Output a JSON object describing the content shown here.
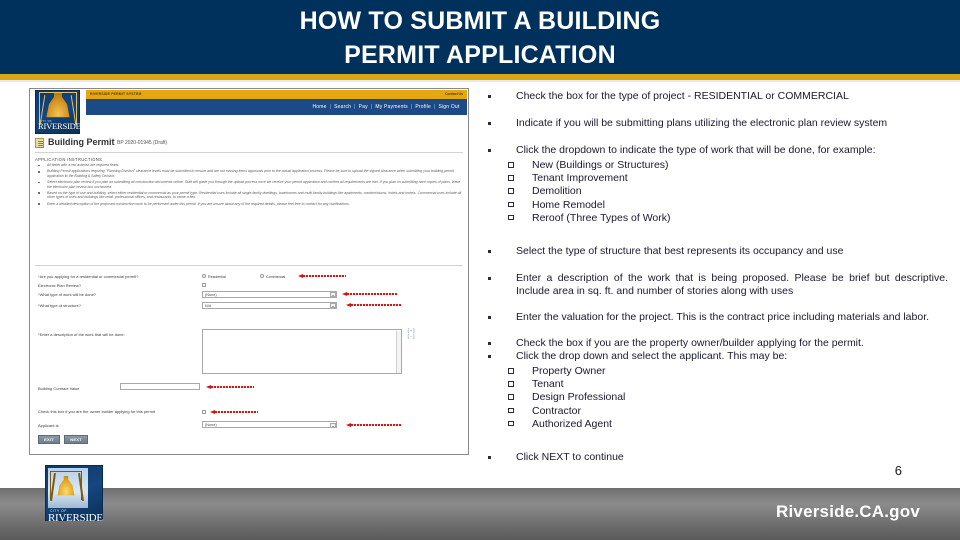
{
  "slide": {
    "title_line1": "HOW TO SUBMIT A BUILDING",
    "title_line2": "PERMIT APPLICATION",
    "page_number": "6",
    "footer_text": "Riverside.CA.gov",
    "colors": {
      "navy": "#00305c",
      "gold": "#d8a715",
      "footer_gray": "#6f6f6f",
      "annotation_red": "#d01616"
    }
  },
  "screenshot": {
    "brand": {
      "city_of": "CITY OF",
      "city_name": "RIVERSIDE"
    },
    "gold_bar_left": "RIVERSIDE PERMIT SYSTEM",
    "gold_bar_right": "Contact Us",
    "nav_links": [
      "Home",
      "Search",
      "Pay",
      "My Payments",
      "Profile",
      "Sign Out"
    ],
    "nav_separator": "|",
    "doc_title": "Building Permit",
    "doc_subtitle": "BP 2020-01945 (Draft)",
    "instructions_heading": "APPLICATION INSTRUCTIONS",
    "instructions": [
      "All fields with a red asterisk are required fields.",
      "Building Permit applications requiring \"Planning Division\" clearance levels must be submitted to ensure and are not missing items approvals prior to the actual application process. Please be sure to upload the signed clearance when submitting your building permit application to the Building & Safety Division.",
      "Select electronic plan review if you plan on submitting all construction documents online. Staff will guide you through the upload process once we receive your permit application and confirm all requirements are met. If you plan on submitting hard copies of plans, leave the electronic plan review box unchecked.",
      "Based on the type of use and building, select either residential or commercial as your permit type. Residential uses include all single-family dwellings, townhomes and multi-family buildings like apartments, condominiums, hotels and motels. Commercial uses include all other types of uses and buildings like retail, professional offices, and restaurants, to name a few.",
      "Enter a detailed description of the proposed construction work to be performed under this permit. If you are unsure about any of the required details, please feel free to contact for any clarifications."
    ],
    "form": {
      "q_permit_type": "Are you applying for a residential or commercial permit?",
      "opt_residential": "Residential",
      "opt_commercial": "Commercial",
      "q_electronic_plan_review": "Electronic Plan Review?",
      "q_type_of_work": "What type of work will be done?",
      "v_type_of_work": "(None)",
      "q_type_of_structure": "What type of structure?",
      "v_type_of_structure": "N/A",
      "q_description": "Enter a description of the work that will be done:",
      "v_description": "",
      "q_contract_value": "Building Contract Value",
      "v_contract_value": "",
      "q_owner_builder": "Check this box if you are the owner builder applying for this permit",
      "q_applicant_is": "Applicant is:",
      "v_applicant_is": "(None)",
      "btn_exit": "EXIT",
      "btn_next": "NEXT",
      "expand_icon": "[+]",
      "collapse_icon": "[-]"
    }
  },
  "bullets": [
    {
      "text": "Check the box for the type of project - RESIDENTIAL or COMMERCIAL",
      "sub": []
    },
    {
      "text": "Indicate if you will be submitting plans utilizing the electronic plan review system",
      "sub": []
    },
    {
      "text": "Click the dropdown to indicate the type of work that will be done, for example:",
      "sub": [
        "New (Buildings or Structures)",
        "Tenant Improvement",
        "Demolition",
        "Home Remodel",
        "Reroof (Three Types of Work)"
      ]
    },
    {
      "text": "Select the type of structure that best represents its occupancy and use",
      "sub": []
    },
    {
      "text": "Enter a description of the work that is being proposed. Please be brief but descriptive. Include area in sq. ft. and number of stories along with uses",
      "sub": []
    },
    {
      "text": "Enter the valuation for the project. This is the contract price including materials and labor.",
      "sub": []
    },
    {
      "text": "Check the box if you are the property owner/builder applying for the permit.",
      "sub": []
    },
    {
      "text": "Click the drop down and select the applicant.  This may be:",
      "sub": [
        "Property Owner",
        "Tenant",
        "Design Professional",
        "Contractor",
        "Authorized Agent"
      ]
    },
    {
      "text": "Click NEXT to continue",
      "sub": []
    }
  ]
}
